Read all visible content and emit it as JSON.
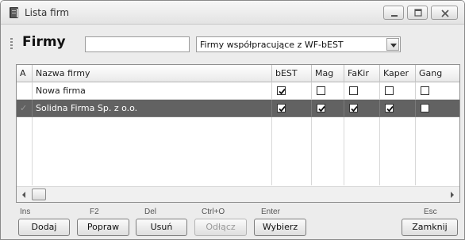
{
  "window": {
    "title": "Lista firm",
    "icon": "book-icon"
  },
  "toolbar": {
    "title": "Firmy",
    "search_value": "",
    "filter_selected": "Firmy współpracujące z WF-bEST"
  },
  "grid": {
    "columns": [
      "A",
      "Nazwa firmy",
      "bEST",
      "Mag",
      "FaKir",
      "Kaper",
      "Gang"
    ],
    "rows": [
      {
        "a": "",
        "name": "Nowa firma",
        "checks": {
          "bEST": true,
          "Mag": false,
          "FaKir": false,
          "Kaper": false,
          "Gang": false
        },
        "selected": false
      },
      {
        "a": "✓",
        "name": "Solidna Firma Sp. z o.o.",
        "checks": {
          "bEST": true,
          "Mag": true,
          "FaKir": true,
          "Kaper": true,
          "Gang": false
        },
        "selected": true
      }
    ]
  },
  "buttons": {
    "add": {
      "label": "Dodaj",
      "key": "Ins"
    },
    "edit": {
      "label": "Popraw",
      "key": "F2"
    },
    "delete": {
      "label": "Usuń",
      "key": "Del"
    },
    "detach": {
      "label": "Odłącz",
      "key": "Ctrl+O",
      "disabled": true
    },
    "select": {
      "label": "Wybierz",
      "key": "Enter"
    },
    "close": {
      "label": "Zamknij",
      "key": "Esc"
    }
  },
  "colors": {
    "selected_row": "#626262",
    "window_bg": "#ececec"
  }
}
